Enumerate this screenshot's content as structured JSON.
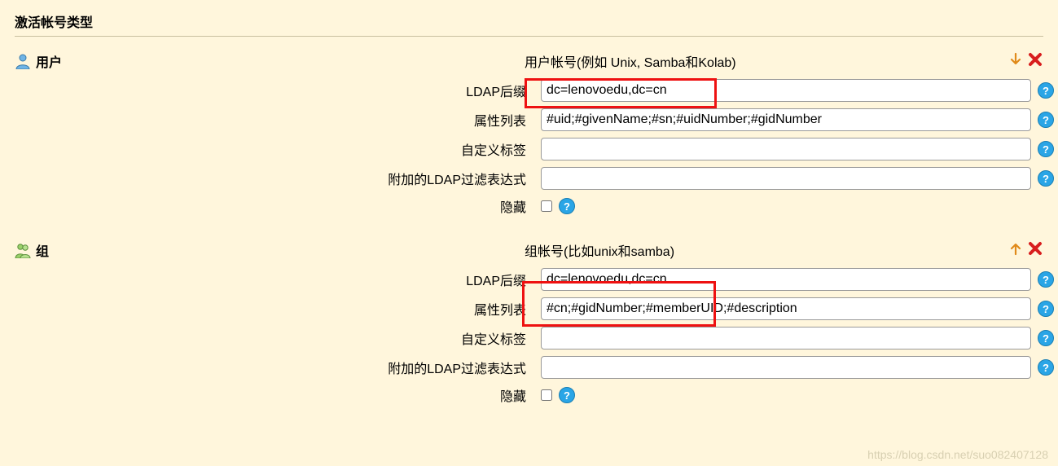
{
  "heading": "激活帐号类型",
  "sections": [
    {
      "title": "用户",
      "subtitle": "用户帐号(例如 Unix, Samba和Kolab)",
      "fields": {
        "ldap_suffix_label": "LDAP后缀",
        "ldap_suffix_value": "dc=lenovoedu,dc=cn",
        "attr_list_label": "属性列表",
        "attr_list_value": "#uid;#givenName;#sn;#uidNumber;#gidNumber",
        "custom_label_label": "自定义标签",
        "custom_label_value": "",
        "filter_label": "附加的LDAP过滤表达式",
        "filter_value": "",
        "hidden_label": "隐藏"
      }
    },
    {
      "title": "组",
      "subtitle": "组帐号(比如unix和samba)",
      "fields": {
        "ldap_suffix_label": "LDAP后缀",
        "ldap_suffix_value": "dc=lenovoedu,dc=cn",
        "attr_list_label": "属性列表",
        "attr_list_value": "#cn;#gidNumber;#memberUID;#description",
        "custom_label_label": "自定义标签",
        "custom_label_value": "",
        "filter_label": "附加的LDAP过滤表达式",
        "filter_value": "",
        "hidden_label": "隐藏"
      }
    }
  ],
  "watermark": "https://blog.csdn.net/suo082407128"
}
